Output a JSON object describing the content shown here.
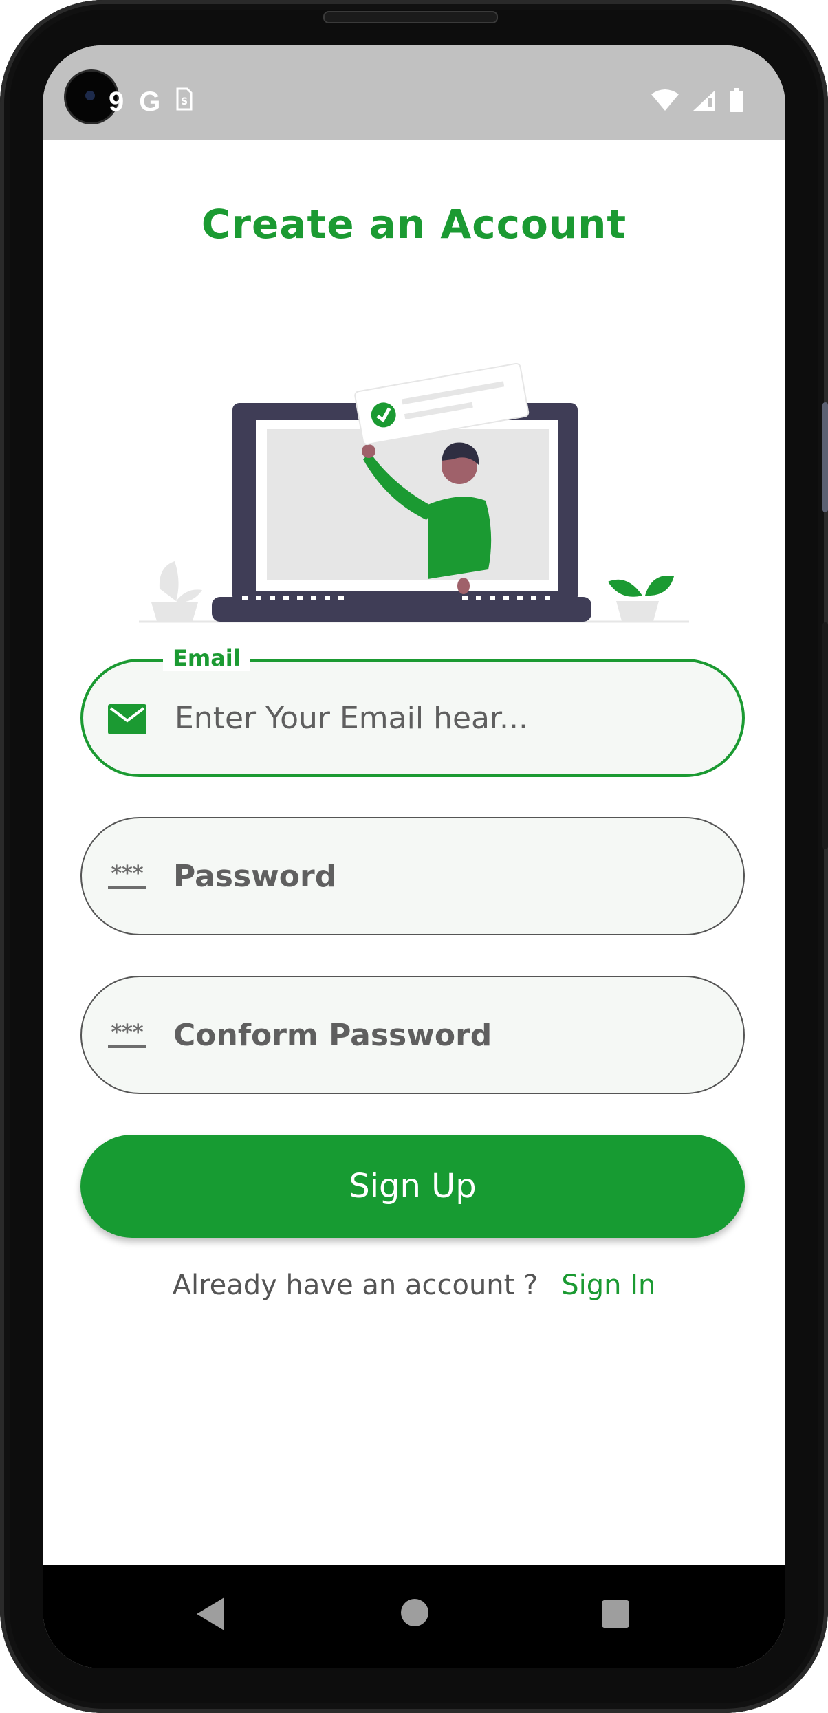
{
  "status_bar": {
    "left_icons": [
      "notification-digit-9",
      "google-g-icon",
      "sim-icon"
    ],
    "left_digit": "9",
    "google_letter": "G",
    "right_icons": [
      "wifi-icon",
      "signal-icon",
      "battery-icon"
    ]
  },
  "page": {
    "title": "Create an Account"
  },
  "form": {
    "email": {
      "label": "Email",
      "placeholder": "Enter Your Email hear...",
      "icon": "mail-icon"
    },
    "password": {
      "placeholder": "Password",
      "icon": "password-icon",
      "icon_glyph": "***"
    },
    "confirm_password": {
      "placeholder": "Conform Password",
      "icon": "password-icon",
      "icon_glyph": "***"
    },
    "signup_label": "Sign Up"
  },
  "footer": {
    "question": "Already have an account ?",
    "link": "Sign In"
  },
  "nav_bar": {
    "buttons": [
      "back-icon",
      "home-icon",
      "recents-icon"
    ]
  },
  "colors": {
    "accent": "#1b9a32",
    "statusbar": "#c1c1c1",
    "field_bg": "#f5f8f5",
    "laptop": "#3f3d56"
  }
}
